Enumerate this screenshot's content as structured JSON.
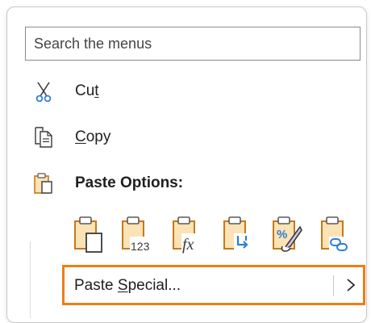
{
  "search": {
    "placeholder": "Search the menus"
  },
  "items": [
    {
      "name": "cut",
      "pre": "Cu",
      "key": "t",
      "post": ""
    },
    {
      "name": "copy",
      "pre": "",
      "key": "C",
      "post": "opy"
    }
  ],
  "paste_options": {
    "header": "Paste Options:",
    "buttons": [
      "paste-icon",
      "paste-values-icon",
      "paste-formulas-icon",
      "paste-transpose-icon",
      "paste-formatting-icon",
      "paste-link-icon"
    ]
  },
  "paste_special": {
    "pre": "Paste ",
    "key": "S",
    "post": "pecial..."
  },
  "colors": {
    "clipboard": "#c47a1b",
    "clipboard_fill": "#fbe3b5",
    "accent_blue": "#2d7fd3",
    "highlight": "#f07d12"
  }
}
